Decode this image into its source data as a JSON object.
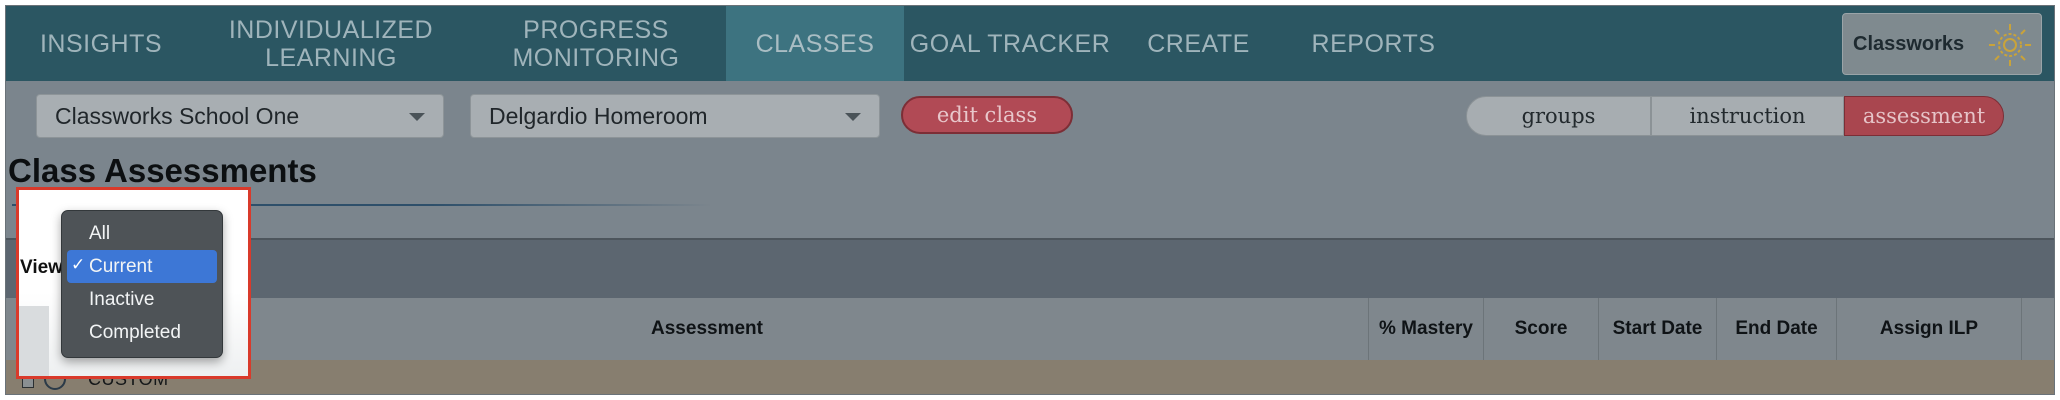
{
  "nav": {
    "items": [
      {
        "label": "INSIGHTS"
      },
      {
        "label": "INDIVIDUALIZED\nLEARNING"
      },
      {
        "label": "PROGRESS\nMONITORING"
      },
      {
        "label": "CLASSES"
      },
      {
        "label": "GOAL TRACKER"
      },
      {
        "label": "CREATE"
      },
      {
        "label": "REPORTS"
      }
    ],
    "active": "CLASSES",
    "brand": "Classworks"
  },
  "controls": {
    "school_select": "Classworks School One",
    "class_select": "Delgardio Homeroom",
    "edit_class": "edit class",
    "segments": [
      {
        "label": "groups"
      },
      {
        "label": "instruction"
      },
      {
        "label": "assessment"
      }
    ],
    "active_segment": "assessment"
  },
  "page": {
    "title": "Class Assessments",
    "view_label": "View"
  },
  "view_menu": {
    "options": [
      "All",
      "Current",
      "Inactive",
      "Completed"
    ],
    "selected": "Current",
    "check": "✓"
  },
  "table": {
    "columns": [
      "Assessment",
      "% Mastery",
      "Score",
      "Start Date",
      "End Date",
      "Assign ILP"
    ],
    "rows": [
      {
        "name": "CUSTOM"
      }
    ]
  },
  "colors": {
    "nav_bg": "#2b5662",
    "nav_active": "#3d7380",
    "accent_red": "#b14a55",
    "highlight_outline": "#d93a2b",
    "menu_selected": "#3d77d6"
  }
}
